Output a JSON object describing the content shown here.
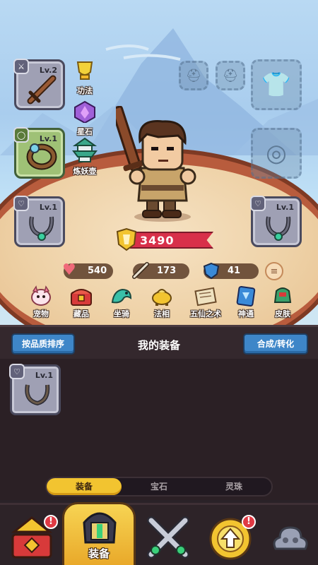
{
  "equipment_slots": {
    "weapon": {
      "level": "Lv.2"
    },
    "ring": {
      "level": "Lv.1"
    },
    "necklace_left": {
      "level": "Lv.1"
    },
    "necklace_right": {
      "level": "Lv.1"
    }
  },
  "side_features": [
    {
      "label": "功法",
      "icon": "trophy-icon"
    },
    {
      "label": "星石",
      "icon": "star-gem-icon"
    },
    {
      "label": "炼妖壶",
      "icon": "pagoda-icon"
    }
  ],
  "hero": {
    "power": "3490"
  },
  "stats": {
    "hp": "540",
    "attack": "173",
    "defense": "41"
  },
  "functions": [
    {
      "label": "宠物",
      "icon": "pet-icon"
    },
    {
      "label": "藏品",
      "icon": "treasure-chest-icon"
    },
    {
      "label": "坐骑",
      "icon": "mount-icon"
    },
    {
      "label": "法相",
      "icon": "incense-burner-icon"
    },
    {
      "label": "五仙之术",
      "icon": "scroll-icon"
    },
    {
      "label": "神通",
      "icon": "spell-book-icon"
    },
    {
      "label": "皮肤",
      "icon": "armor-skin-icon"
    }
  ],
  "bag": {
    "sort_label": "按品质排序",
    "title": "我的装备",
    "merge_label": "合成/转化",
    "items": [
      {
        "level": "Lv.1",
        "icon": "necklace-icon"
      }
    ]
  },
  "subtabs": [
    "装备",
    "宝石",
    "灵珠"
  ],
  "nav": {
    "equip_label": "装备",
    "badge": "!"
  }
}
